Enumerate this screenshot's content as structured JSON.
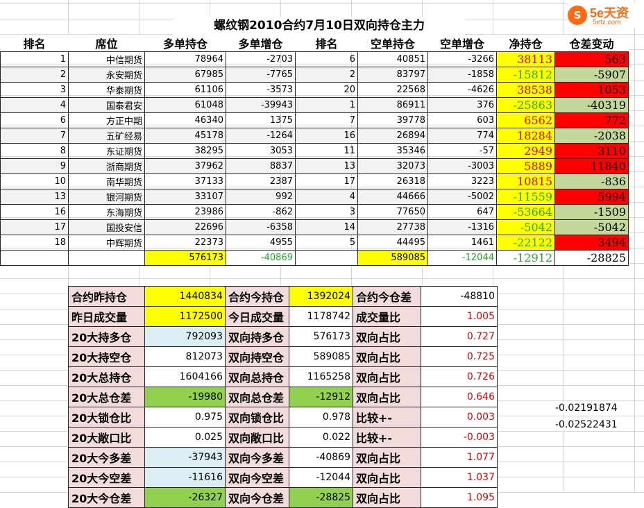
{
  "title": "螺纹钢2010合约7月10日双向持仓主力",
  "logo": {
    "mark": "S",
    "main": "5e天资",
    "sub": "5etz.com"
  },
  "headers": [
    "排名",
    "席位",
    "多单持仓",
    "多单增仓",
    "排名",
    "空单持仓",
    "空单增仓",
    "净持仓",
    "仓差变动"
  ],
  "rows": [
    {
      "rank": "1",
      "seat": "中信期货",
      "long": "78964",
      "long_chg": "-2703",
      "srank": "6",
      "short": "40851",
      "short_chg": "-3266",
      "net": "38113",
      "diff": "563"
    },
    {
      "rank": "2",
      "seat": "永安期货",
      "long": "67985",
      "long_chg": "-7765",
      "srank": "2",
      "short": "83797",
      "short_chg": "-1858",
      "net": "-15812",
      "diff": "-5907"
    },
    {
      "rank": "3",
      "seat": "华泰期货",
      "long": "61106",
      "long_chg": "-3573",
      "srank": "20",
      "short": "22568",
      "short_chg": "-4626",
      "net": "38538",
      "diff": "1053"
    },
    {
      "rank": "4",
      "seat": "国泰君安",
      "long": "61048",
      "long_chg": "-39943",
      "srank": "1",
      "short": "86911",
      "short_chg": "376",
      "net": "-25863",
      "diff": "-40319"
    },
    {
      "rank": "6",
      "seat": "方正中期",
      "long": "46340",
      "long_chg": "1375",
      "srank": "7",
      "short": "39778",
      "short_chg": "603",
      "net": "6562",
      "diff": "772"
    },
    {
      "rank": "7",
      "seat": "五矿经易",
      "long": "45178",
      "long_chg": "-1264",
      "srank": "16",
      "short": "26894",
      "short_chg": "774",
      "net": "18284",
      "diff": "-2038"
    },
    {
      "rank": "8",
      "seat": "东证期货",
      "long": "38295",
      "long_chg": "3053",
      "srank": "11",
      "short": "35346",
      "short_chg": "-57",
      "net": "2949",
      "diff": "3110"
    },
    {
      "rank": "9",
      "seat": "浙商期货",
      "long": "37962",
      "long_chg": "8837",
      "srank": "13",
      "short": "32073",
      "short_chg": "-3003",
      "net": "5889",
      "diff": "11840"
    },
    {
      "rank": "10",
      "seat": "南华期货",
      "long": "37133",
      "long_chg": "2387",
      "srank": "17",
      "short": "26318",
      "short_chg": "3223",
      "net": "10815",
      "diff": "-836"
    },
    {
      "rank": "13",
      "seat": "银河期货",
      "long": "33107",
      "long_chg": "992",
      "srank": "4",
      "short": "44666",
      "short_chg": "-5002",
      "net": "-11559",
      "diff": "5994"
    },
    {
      "rank": "16",
      "seat": "东海期货",
      "long": "23986",
      "long_chg": "-862",
      "srank": "3",
      "short": "77650",
      "short_chg": "647",
      "net": "-53664",
      "diff": "-1509"
    },
    {
      "rank": "17",
      "seat": "国投安信",
      "long": "22696",
      "long_chg": "-6358",
      "srank": "14",
      "short": "27738",
      "short_chg": "-1316",
      "net": "-5042",
      "diff": "-5042"
    },
    {
      "rank": "18",
      "seat": "中辉期货",
      "long": "22373",
      "long_chg": "4955",
      "srank": "5",
      "short": "44495",
      "short_chg": "1461",
      "net": "-22122",
      "diff": "3494"
    }
  ],
  "totals": {
    "long": "576173",
    "long_chg": "-40869",
    "short": "589085",
    "short_chg": "-12044",
    "net": "-12912",
    "diff": "-28825"
  },
  "summary": [
    {
      "l1": "合约昨持仓",
      "v1": "1440834",
      "l2": "合约今持仓",
      "v2": "1392024",
      "l3": "合约今仓差",
      "v3": "-48810"
    },
    {
      "l1": "昨日成交量",
      "v1": "1172500",
      "l2": "今日成交量",
      "v2": "1178742",
      "l3": "成交量比",
      "v3": "1.005"
    },
    {
      "l1": "20大持多仓",
      "v1": "792093",
      "l2": "双向持多仓",
      "v2": "576173",
      "l3": "双向占比",
      "v3": "0.727"
    },
    {
      "l1": "20大持空仓",
      "v1": "812073",
      "l2": "双向持空仓",
      "v2": "589085",
      "l3": "双向占比",
      "v3": "0.725"
    },
    {
      "l1": "20大总持仓",
      "v1": "1604166",
      "l2": "双向总持仓",
      "v2": "1165258",
      "l3": "双向占比",
      "v3": "0.726"
    },
    {
      "l1": "20大总仓差",
      "v1": "-19980",
      "l2": "双向总仓差",
      "v2": "-12912",
      "l3": "双向占比",
      "v3": "0.646"
    },
    {
      "l1": "20大锁仓比",
      "v1": "0.975",
      "l2": "双向锁仓比",
      "v2": "0.978",
      "l3": "比较+-",
      "v3": "0.003"
    },
    {
      "l1": "20大敞口比",
      "v1": "0.025",
      "l2": "双向敞口比",
      "v2": "0.022",
      "l3": "比较+-",
      "v3": "-0.003"
    },
    {
      "l1": "20大今多差",
      "v1": "-37943",
      "l2": "双向今多差",
      "v2": "-40869",
      "l3": "双向占比",
      "v3": "1.077"
    },
    {
      "l1": "20大今空差",
      "v1": "-11616",
      "l2": "双向今空差",
      "v2": "-12044",
      "l3": "双向占比",
      "v3": "1.037"
    },
    {
      "l1": "20大今仓差",
      "v1": "-26327",
      "l2": "双向今仓差",
      "v2": "-28825",
      "l3": "双向占比",
      "v3": "1.095"
    }
  ],
  "side_values": [
    "-0.02191874",
    "-0.02522431"
  ],
  "colors": {
    "yellow": "#ffff00",
    "red": "#ff0000",
    "green_cell": "#c4d79b",
    "green_text": "#22aa22",
    "red_text": "#e00000",
    "pink_label": "#f2dcdb",
    "light_blue": "#dbeef4",
    "bright_green": "#92d050"
  }
}
